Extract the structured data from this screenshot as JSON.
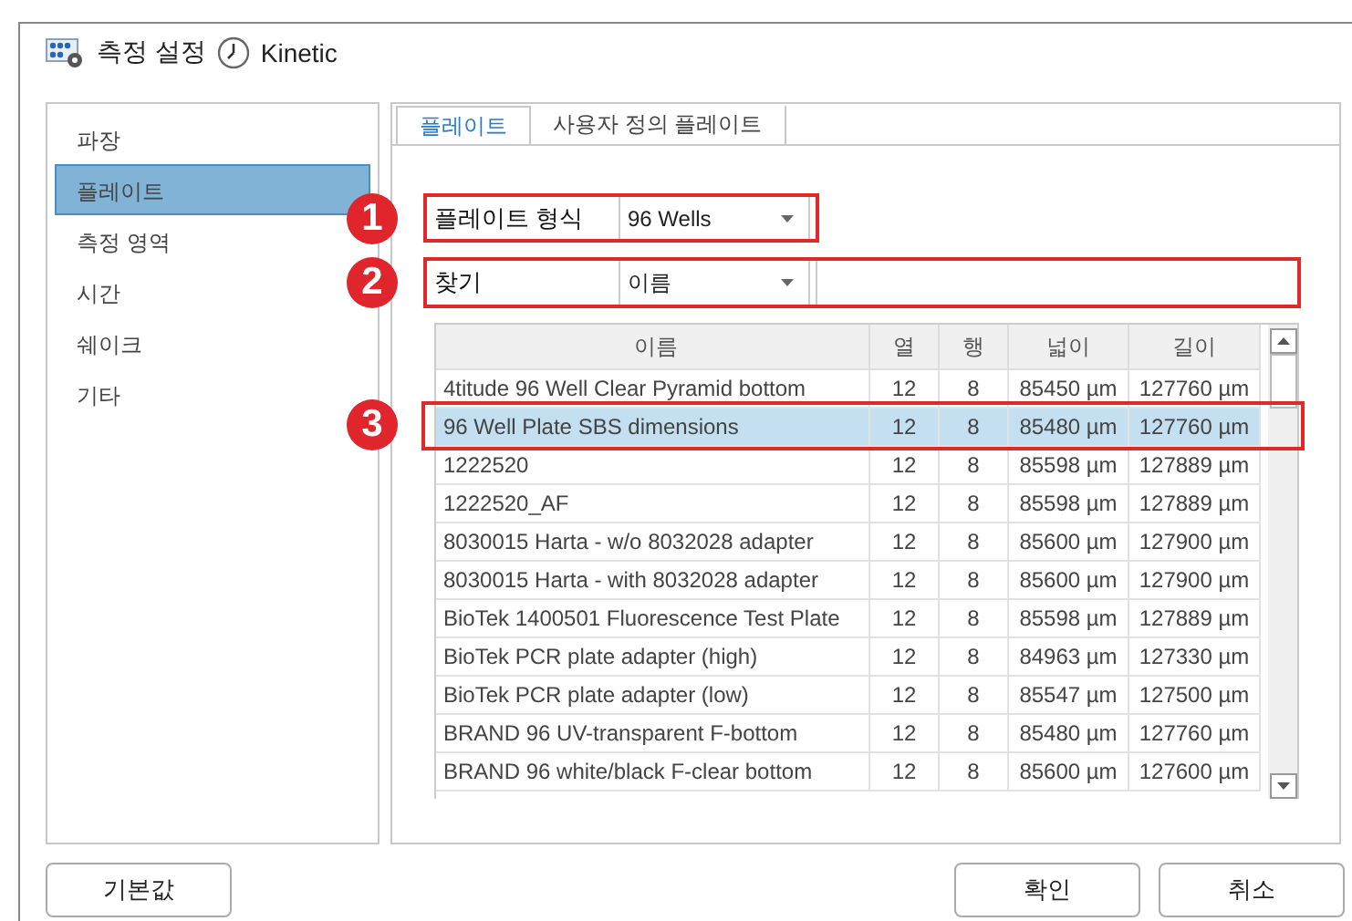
{
  "window": {
    "title": "측정 설정",
    "mode": "Kinetic"
  },
  "sidebar": {
    "items": [
      {
        "label": "파장",
        "selected": false
      },
      {
        "label": "플레이트",
        "selected": true
      },
      {
        "label": "측정 영역",
        "selected": false
      },
      {
        "label": "시간",
        "selected": false
      },
      {
        "label": "쉐이크",
        "selected": false
      },
      {
        "label": "기타",
        "selected": false
      }
    ]
  },
  "tabs": [
    {
      "label": "플레이트",
      "selected": true
    },
    {
      "label": "사용자 정의 플레이트",
      "selected": false
    }
  ],
  "plate_format": {
    "badge": "1",
    "label": "플레이트 형식",
    "value": "96 Wells"
  },
  "search": {
    "badge": "2",
    "label": "찾기",
    "field": "이름"
  },
  "table": {
    "annotation_badge": "3",
    "columns": [
      "이름",
      "열",
      "행",
      "넓이",
      "길이"
    ],
    "rows": [
      {
        "cells": [
          "4titude 96 Well Clear Pyramid bottom",
          "12",
          "8",
          "85450 µm",
          "127760 µm"
        ],
        "selected": false,
        "annotated": false
      },
      {
        "cells": [
          "96 Well Plate SBS dimensions",
          "12",
          "8",
          "85480 µm",
          "127760 µm"
        ],
        "selected": true,
        "annotated": true
      },
      {
        "cells": [
          "1222520",
          "12",
          "8",
          "85598 µm",
          "127889 µm"
        ],
        "selected": false,
        "annotated": false
      },
      {
        "cells": [
          "1222520_AF",
          "12",
          "8",
          "85598 µm",
          "127889 µm"
        ],
        "selected": false,
        "annotated": false
      },
      {
        "cells": [
          "8030015 Harta - w/o 8032028 adapter",
          "12",
          "8",
          "85600 µm",
          "127900 µm"
        ],
        "selected": false,
        "annotated": false
      },
      {
        "cells": [
          "8030015 Harta - with 8032028 adapter",
          "12",
          "8",
          "85600 µm",
          "127900 µm"
        ],
        "selected": false,
        "annotated": false
      },
      {
        "cells": [
          "BioTek 1400501 Fluorescence Test Plate",
          "12",
          "8",
          "85598 µm",
          "127889 µm"
        ],
        "selected": false,
        "annotated": false
      },
      {
        "cells": [
          "BioTek PCR plate adapter (high)",
          "12",
          "8",
          "84963 µm",
          "127330 µm"
        ],
        "selected": false,
        "annotated": false
      },
      {
        "cells": [
          "BioTek PCR plate adapter (low)",
          "12",
          "8",
          "85547 µm",
          "127500 µm"
        ],
        "selected": false,
        "annotated": false
      },
      {
        "cells": [
          "BRAND 96 UV-transparent F-bottom",
          "12",
          "8",
          "85480 µm",
          "127760 µm"
        ],
        "selected": false,
        "annotated": false
      },
      {
        "cells": [
          "BRAND 96 white/black F-clear bottom",
          "12",
          "8",
          "85600 µm",
          "127600 µm"
        ],
        "selected": false,
        "annotated": false
      }
    ]
  },
  "buttons": {
    "left": [
      "기본값"
    ],
    "right": [
      "확인",
      "취소"
    ]
  }
}
